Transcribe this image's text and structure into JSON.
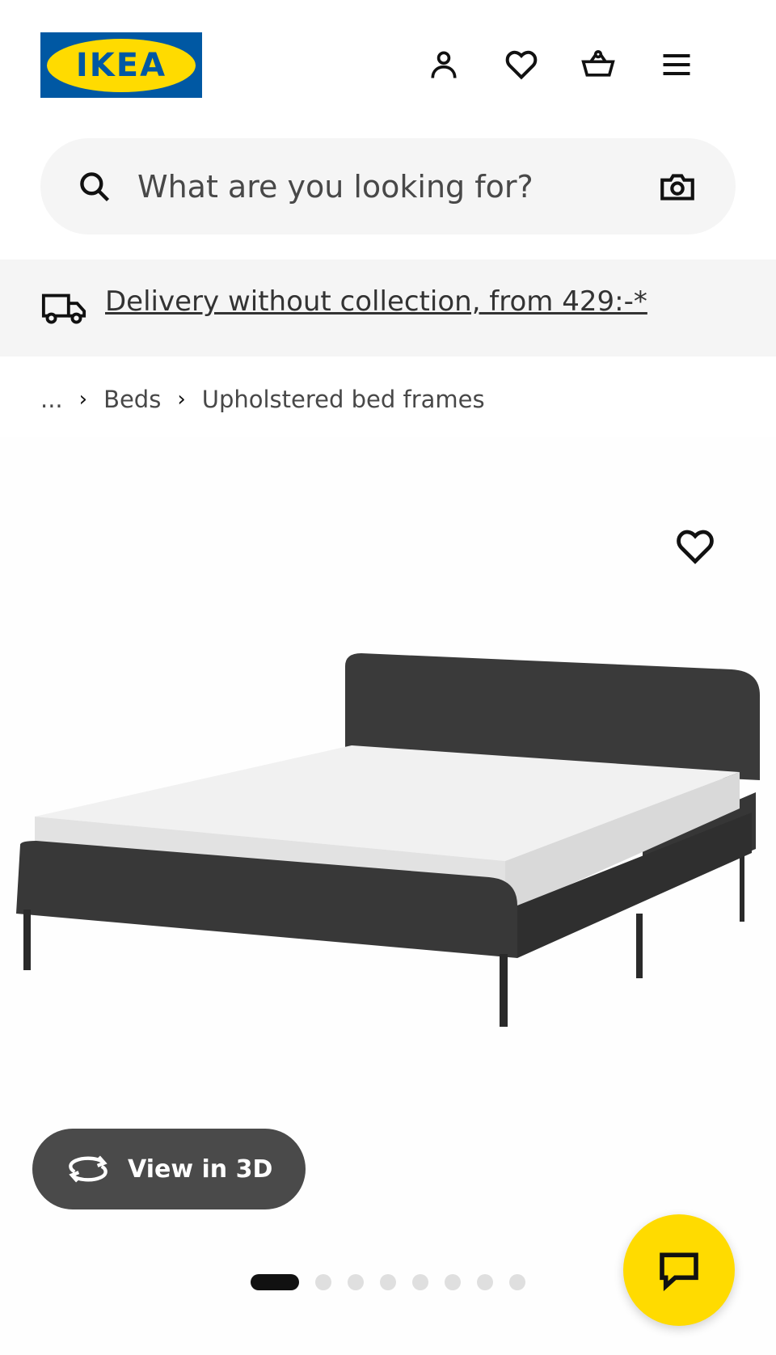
{
  "header": {
    "logo_text": "IKEA",
    "icons": [
      "profile-icon",
      "heart-icon",
      "basket-icon",
      "menu-icon"
    ]
  },
  "search": {
    "placeholder": "What are you looking for?",
    "icons": [
      "search-icon",
      "camera-icon"
    ]
  },
  "delivery": {
    "icon": "truck-icon",
    "text": "Delivery without collection, from 429:-*"
  },
  "breadcrumb": {
    "items": [
      "...",
      "Beds",
      "Upholstered bed frames"
    ],
    "separator_icon": "chevron-right-icon"
  },
  "product": {
    "image_alt": "Upholstered bed frame with mattress",
    "favourite_icon": "heart-icon",
    "view3d_label": "View in 3D",
    "carousel": {
      "total": 8,
      "active_index": 1
    }
  },
  "chat": {
    "icon": "chat-bubble-icon"
  },
  "colors": {
    "ikea_blue": "#0058a3",
    "ikea_yellow": "#ffdb00",
    "surface_grey": "#f5f5f5",
    "button_dark": "#4a4a4a"
  }
}
